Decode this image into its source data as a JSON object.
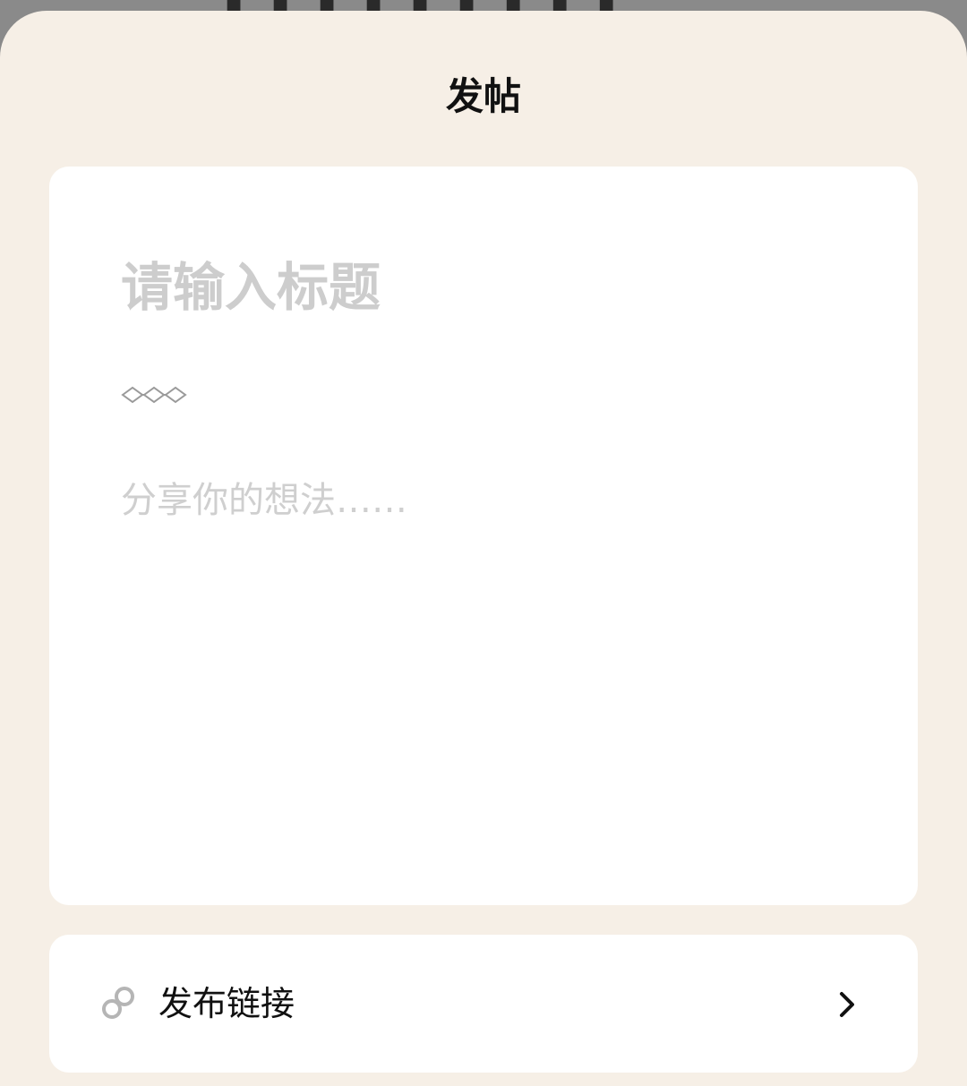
{
  "sheet": {
    "title": "发帖"
  },
  "editor": {
    "title_placeholder": "请输入标题",
    "title_value": "",
    "body_placeholder": "分享你的想法……",
    "body_value": "",
    "divider_icon": "diamond-chain-icon"
  },
  "link_row": {
    "label": "发布链接",
    "icon": "link-icon",
    "chevron_icon": "chevron-right-icon"
  },
  "colors": {
    "sheet_background": "#f6efe6",
    "card_background": "#ffffff",
    "placeholder": "#cdcdcd",
    "text": "#111111",
    "icon_gray": "#b5b5b5"
  }
}
